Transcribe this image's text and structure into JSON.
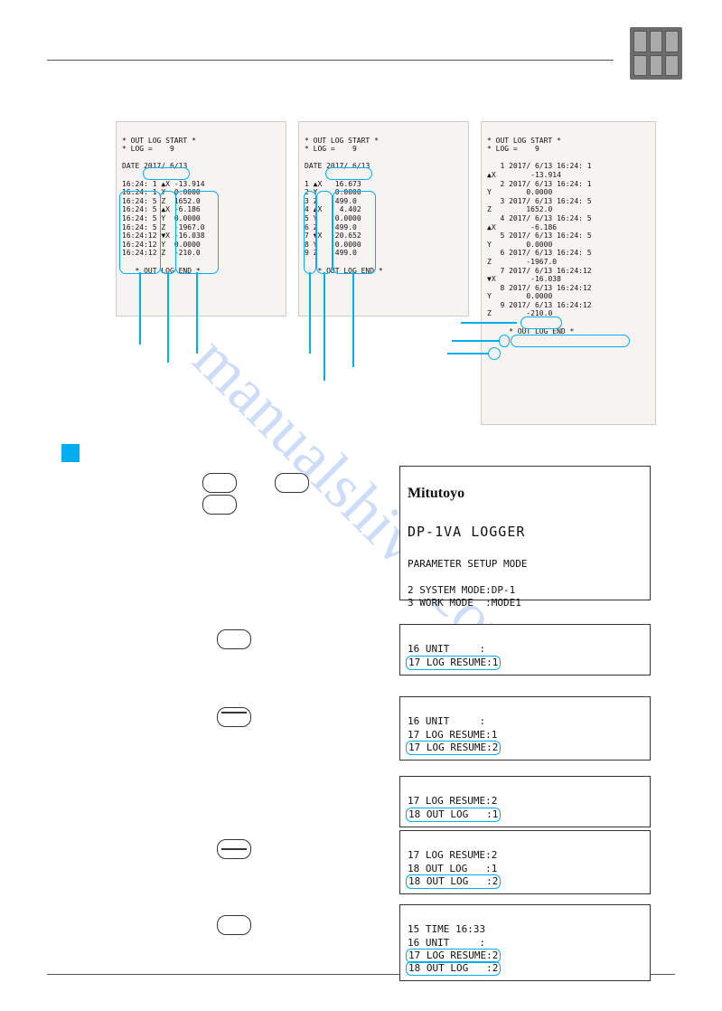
{
  "slip1": {
    "header1": "* OUT LOG START *",
    "header2": "* LOG =    9",
    "date_label": "DATE",
    "date_value": "2017/ 6/13",
    "rows": [
      [
        "16:24: 1",
        "▲X",
        "-13.914"
      ],
      [
        "16:24: 1",
        "Y",
        "0.0000"
      ],
      [
        "16:24: 5",
        "Z",
        "1652.0"
      ],
      [
        "16:24: 5",
        "▲X",
        "-6.186"
      ],
      [
        "16:24: 5",
        "Y",
        "0.0000"
      ],
      [
        "16:24: 5",
        "Z",
        "-1967.0"
      ],
      [
        "16:24:12",
        "▼X",
        "-16.038"
      ],
      [
        "16:24:12",
        "Y",
        "0.0000"
      ],
      [
        "16:24:12",
        "Z",
        "-210.0"
      ]
    ],
    "footer": "* OUT LOG END *"
  },
  "slip2": {
    "header1": "* OUT LOG START *",
    "header2": "* LOG =    9",
    "date_label": "DATE",
    "date_value": "2017/ 6/13",
    "rows": [
      [
        "1",
        "▲X",
        "16.673"
      ],
      [
        "2",
        "Y",
        "0.0000"
      ],
      [
        "3",
        "Z",
        "499.0"
      ],
      [
        "4",
        "▲X",
        "4.402"
      ],
      [
        "5",
        "Y",
        "0.0000"
      ],
      [
        "6",
        "Z",
        "499.0"
      ],
      [
        "7",
        "▼X",
        "-20.652"
      ],
      [
        "8",
        "Y",
        "0.0000"
      ],
      [
        "9",
        "Z",
        "499.0"
      ]
    ],
    "footer": "* OUT LOG END *"
  },
  "slip3": {
    "header1": "* OUT LOG START *",
    "header2": "* LOG =    9",
    "rows": [
      [
        "▲X",
        "1 2017/ 6/13 16:24: 1",
        "-13.914"
      ],
      [
        "Y",
        "2 2017/ 6/13 16:24: 1",
        "0.0000"
      ],
      [
        "Z",
        "3 2017/ 6/13 16:24: 5",
        "1652.0"
      ],
      [
        "▲X",
        "4 2017/ 6/13 16:24: 5",
        "-6.186"
      ],
      [
        "Y",
        "5 2017/ 6/13 16:24: 5",
        "0.0000"
      ],
      [
        "Z",
        "6 2017/ 6/13 16:24: 5",
        "-1967.0"
      ],
      [
        "▼X",
        "7 2017/ 6/13 16:24:12",
        "-16.038"
      ],
      [
        "Y",
        "8 2017/ 6/13 16:24:12",
        "0.0000"
      ],
      [
        "Z",
        "9 2017/ 6/13 16:24:12",
        "-210.0"
      ]
    ],
    "footer": "* OUT LOG END *"
  },
  "lcd_main": {
    "brand": "Mitutoyo",
    "title": "DP-1VA LOGGER",
    "sub": "PARAMETER SETUP MODE",
    "line1": "2 SYSTEM MODE:DP-1",
    "line2": "3 WORK MODE  :MODE1"
  },
  "lcd_a": {
    "l1": "16 UNIT     :",
    "l2": "17 LOG RESUME:1"
  },
  "lcd_b": {
    "l1": "16 UNIT     :",
    "l2": "17 LOG RESUME:1",
    "l3": "17 LOG RESUME:2"
  },
  "lcd_c": {
    "l1": "17 LOG RESUME:2",
    "l2": "18 OUT LOG   :1"
  },
  "lcd_d": {
    "l1": "17 LOG RESUME:2",
    "l2": "18 OUT LOG   :1",
    "l3": "18 OUT LOG   :2"
  },
  "lcd_e": {
    "l1": "15 TIME 16:33",
    "l2": "16 UNIT     :",
    "l3": "17 LOG RESUME:2",
    "l4": "18 OUT LOG   :2"
  }
}
